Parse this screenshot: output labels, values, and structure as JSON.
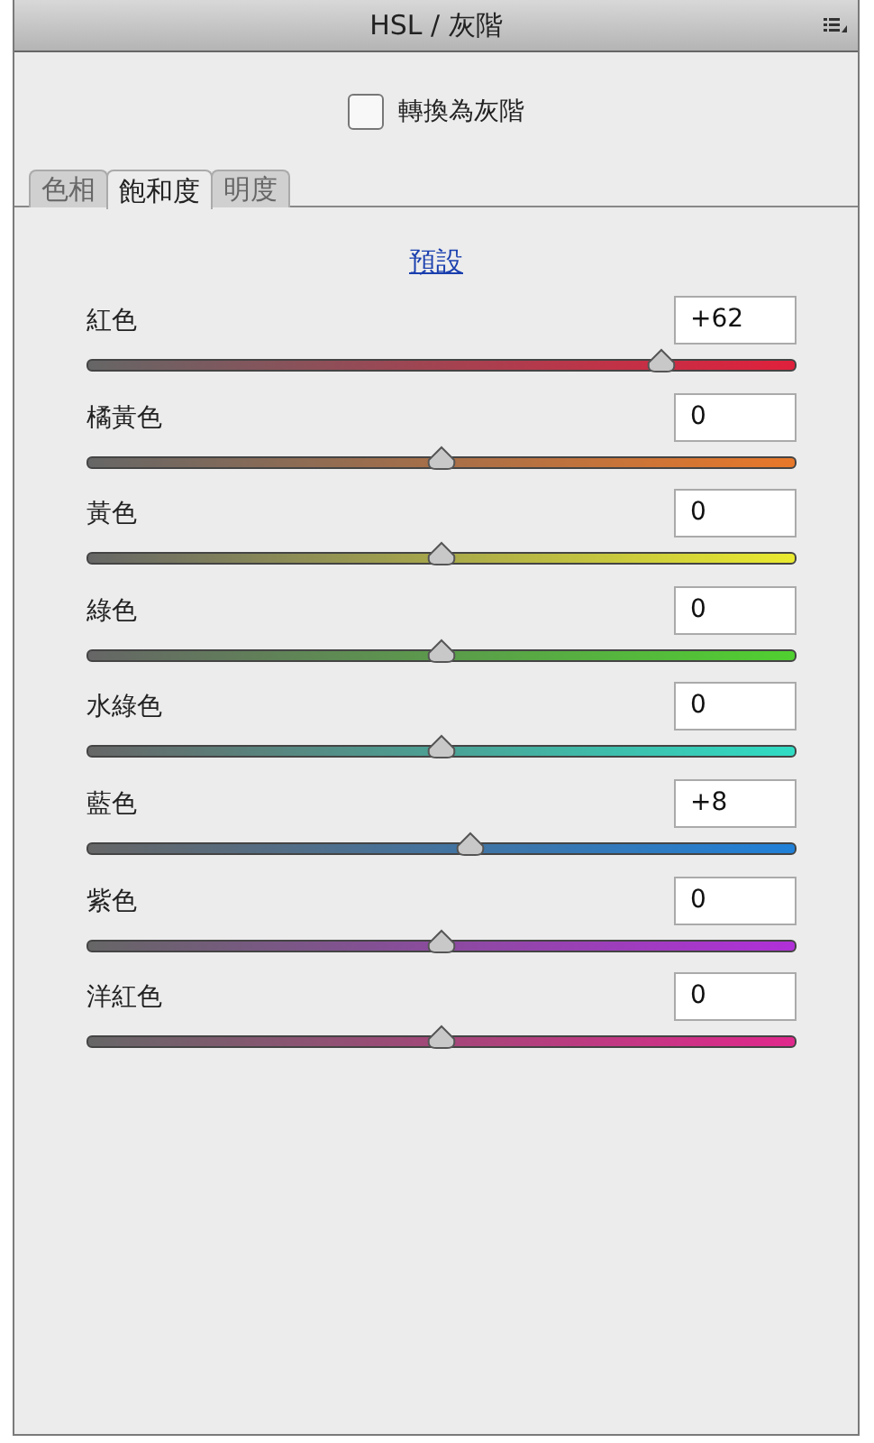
{
  "panel": {
    "title": "HSL / 灰階"
  },
  "grayscale": {
    "label": "轉換為灰階",
    "checked": false
  },
  "tabs": [
    {
      "label": "色相",
      "selected": false
    },
    {
      "label": "飽和度",
      "selected": true
    },
    {
      "label": "明度",
      "selected": false
    }
  ],
  "default_link": "預設",
  "channels": [
    {
      "name": "紅色",
      "value": "+62",
      "level": 0.81,
      "color": "#e0203c"
    },
    {
      "name": "橘黃色",
      "value": "0",
      "level": 0.5,
      "color": "#e8782a"
    },
    {
      "name": "黃色",
      "value": "0",
      "level": 0.5,
      "color": "#eaea30"
    },
    {
      "name": "綠色",
      "value": "0",
      "level": 0.5,
      "color": "#50d030"
    },
    {
      "name": "水綠色",
      "value": "0",
      "level": 0.5,
      "color": "#30dcc4"
    },
    {
      "name": "藍色",
      "value": "+8",
      "level": 0.54,
      "color": "#2080d8"
    },
    {
      "name": "紫色",
      "value": "0",
      "level": 0.5,
      "color": "#b030d8"
    },
    {
      "name": "洋紅色",
      "value": "0",
      "level": 0.5,
      "color": "#e0288c"
    }
  ]
}
